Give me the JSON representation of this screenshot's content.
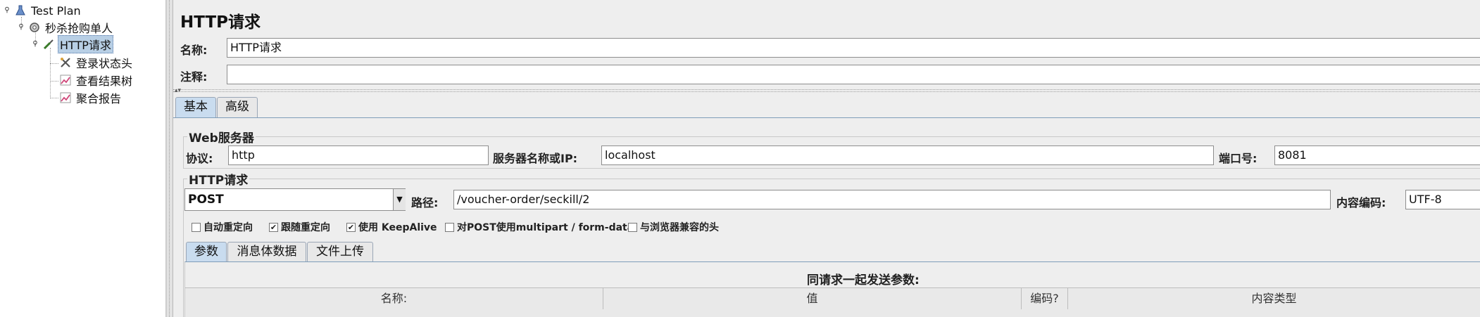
{
  "tree": {
    "items": [
      {
        "label": "Test Plan",
        "icon": "flask-icon"
      },
      {
        "label": "秒杀抢购单人",
        "icon": "gear-icon"
      },
      {
        "label": "HTTP请求",
        "icon": "pipette-icon"
      },
      {
        "label": "登录状态头",
        "icon": "tools-icon"
      },
      {
        "label": "查看结果树",
        "icon": "chart-icon"
      },
      {
        "label": "聚合报告",
        "icon": "chart-icon"
      }
    ]
  },
  "panel": {
    "title": "HTTP请求",
    "name_label": "名称:",
    "name_value": "HTTP请求",
    "comment_label": "注释:",
    "comment_value": ""
  },
  "tabs": {
    "basic": "基本",
    "advanced": "高级"
  },
  "web_server": {
    "title": "Web服务器",
    "protocol_label": "协议:",
    "protocol_value": "http",
    "server_label": "服务器名称或IP:",
    "server_value": "localhost",
    "port_label": "端口号:",
    "port_value": "8081"
  },
  "http_request": {
    "title": "HTTP请求",
    "method": "POST",
    "path_label": "路径:",
    "path_value": "/voucher-order/seckill/2",
    "encoding_label": "内容编码:",
    "encoding_value": "UTF-8"
  },
  "checkboxes": [
    {
      "label": "自动重定向",
      "checked": false,
      "mark": ""
    },
    {
      "label": "跟随重定向",
      "checked": true,
      "mark": "✔"
    },
    {
      "label": "使用 KeepAlive",
      "checked": true,
      "mark": "✔"
    },
    {
      "label": "对POST使用multipart / form-data",
      "checked": false,
      "mark": ""
    },
    {
      "label": "与浏览器兼容的头",
      "checked": false,
      "mark": ""
    }
  ],
  "sub_tabs": {
    "params": "参数",
    "body": "消息体数据",
    "files": "文件上传"
  },
  "params_table": {
    "caption": "同请求一起发送参数:",
    "columns": [
      "名称:",
      "值",
      "编码?",
      "内容类型"
    ]
  },
  "colors": {
    "selection": "#b8cfe5",
    "active_tab": "#c9dcef"
  }
}
